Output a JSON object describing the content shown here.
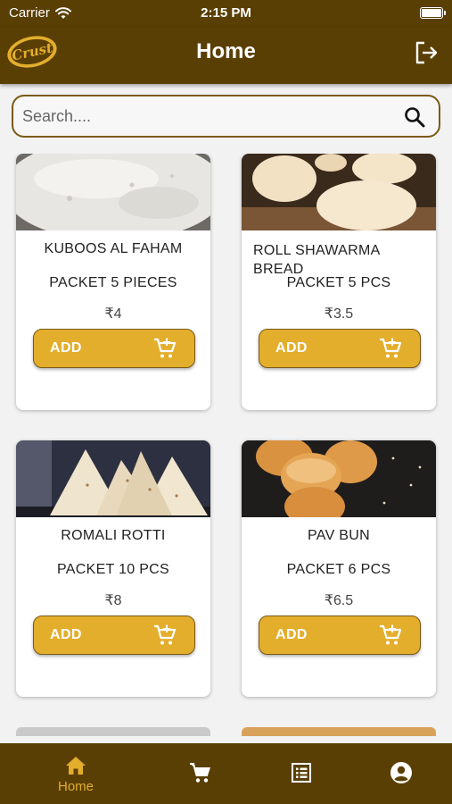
{
  "status_bar": {
    "carrier": "Carrier",
    "time": "2:15 PM"
  },
  "app_bar": {
    "logo_text": "Crust",
    "title": "Home",
    "logout_icon": "logout-icon"
  },
  "search": {
    "placeholder": "Search....",
    "value": "",
    "icon": "search-icon"
  },
  "products": [
    {
      "name": "KUBOOS AL  FAHAM",
      "pack": "PACKET 5 PIECES",
      "price": "₹4",
      "button": "ADD"
    },
    {
      "name": "ROLL SHAWARMA BREAD",
      "pack": "PACKET 5 PCS",
      "price": "₹3.5",
      "button": "ADD"
    },
    {
      "name": "ROMALI ROTTI",
      "pack": "PACKET 10 PCS",
      "price": "₹8",
      "button": "ADD"
    },
    {
      "name": "PAV BUN",
      "pack": "PACKET 6 PCS",
      "price": "₹6.5",
      "button": "ADD"
    }
  ],
  "bottom_nav": [
    {
      "label": "Home",
      "icon": "home-icon",
      "active": true
    },
    {
      "label": "",
      "icon": "cart-icon",
      "active": false
    },
    {
      "label": "",
      "icon": "orders-list-icon",
      "active": false
    },
    {
      "label": "",
      "icon": "account-icon",
      "active": false
    }
  ],
  "colors": {
    "brand_brown": "#5a3f05",
    "accent_gold": "#e3ae2c",
    "background": "#f2f2f2"
  }
}
